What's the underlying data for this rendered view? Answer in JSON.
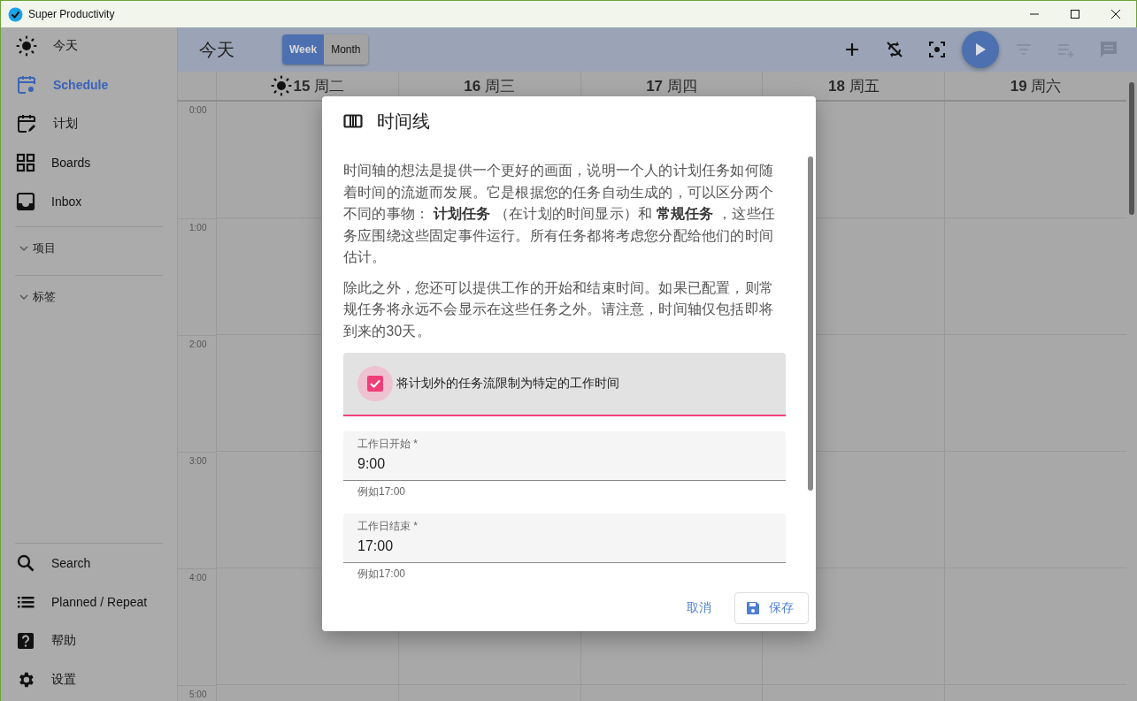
{
  "window": {
    "title": "Super Productivity"
  },
  "sidebar": {
    "items": [
      {
        "label": "今天",
        "selected": false
      },
      {
        "label": "Schedule",
        "selected": true
      },
      {
        "label": "计划",
        "selected": false
      },
      {
        "label": "Boards",
        "selected": false
      },
      {
        "label": "Inbox",
        "selected": false
      }
    ],
    "groups": [
      {
        "label": "项目"
      },
      {
        "label": "标签"
      }
    ],
    "bottom_items": [
      {
        "label": "Search",
        "selected": false
      },
      {
        "label": "Planned / Repeat",
        "selected": false
      },
      {
        "label": "帮助",
        "selected": false
      },
      {
        "label": "设置",
        "selected": false
      }
    ]
  },
  "toolbar": {
    "title": "今天",
    "view_toggle": [
      {
        "label": "Week",
        "selected": true
      },
      {
        "label": "Month",
        "selected": false
      }
    ],
    "actions": [
      {
        "kind": "add"
      },
      {
        "kind": "sync-off"
      },
      {
        "kind": "focus"
      },
      {
        "kind": "play"
      },
      {
        "kind": "filter"
      },
      {
        "kind": "playlist-add"
      },
      {
        "kind": "notes"
      }
    ]
  },
  "calendar": {
    "days": [
      {
        "label": "**15** 周二",
        "today": true
      },
      {
        "label": "**16** 周三",
        "today": false
      },
      {
        "label": "**17** 周四",
        "today": false
      },
      {
        "label": "**18** 周五",
        "today": false
      },
      {
        "label": "**19** 周六",
        "today": false
      }
    ],
    "hours": [
      "0:00",
      "1:00",
      "2:00",
      "3:00",
      "4:00",
      "5:00"
    ]
  },
  "dialog": {
    "title": "时间线",
    "paragraphs": [
      "时间轴的想法是提供一个更好的画面，说明一个人的计划任务如何随着时间的流逝而发展。它是根据您的任务自动生成的，可以区分两个不同的事物： **计划任务** （在计划的时间显示）和 **常规任务** ，这些任务应围绕这些固定事件运行。所有任务都将考虑您分配给他们的时间估计。",
      "除此之外，您还可以提供工作的开始和结束时间。如果已配置，则常规任务将永远不会显示在这些任务之外。请注意，时间轴仅包括即将到来的30天。"
    ],
    "checkbox": {
      "label": "将计划外的任务流限制为特定的工作时间",
      "checked": true
    },
    "fields": [
      {
        "label": "工作日开始 *",
        "value": "9:00",
        "hint": "例如17:00"
      },
      {
        "label": "工作日结束 *",
        "value": "17:00",
        "hint": "例如17:00"
      }
    ],
    "buttons": [
      {
        "kind": "text",
        "label": "取消"
      },
      {
        "kind": "save",
        "label": "保存"
      }
    ]
  }
}
